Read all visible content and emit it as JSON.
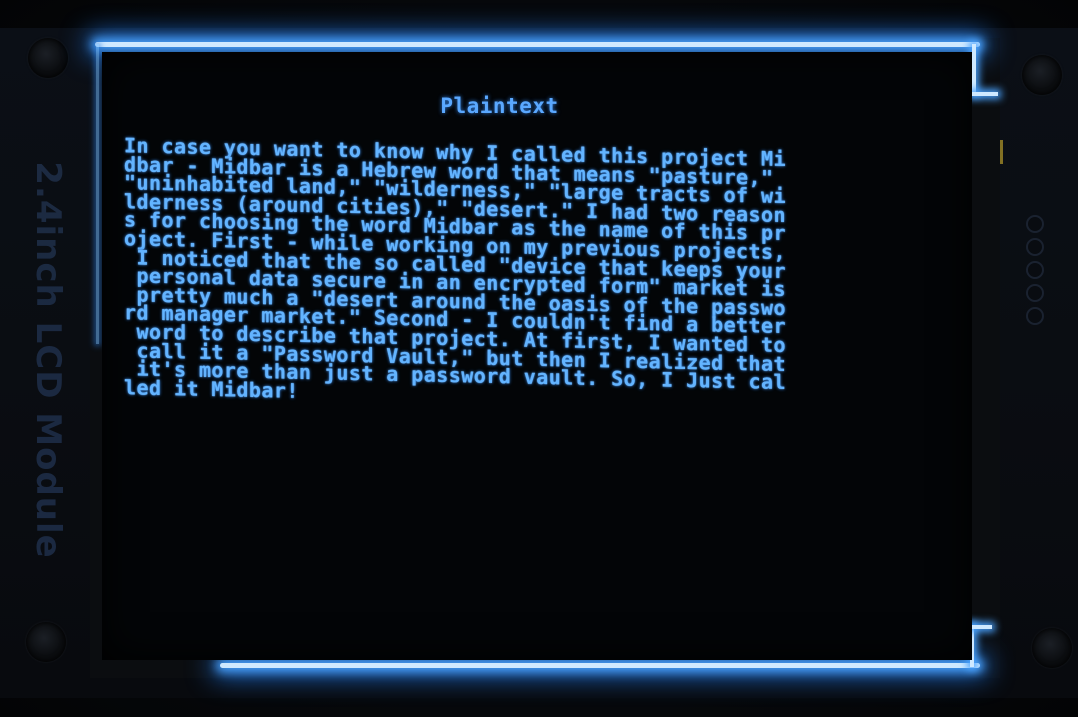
{
  "module": {
    "silkscreen_label": "2.4inch LCD Module"
  },
  "screen": {
    "title": "Plaintext",
    "lines": [
      "In case you want to know why I called this project Mi",
      "dbar - Midbar is a Hebrew word that means \"pasture,\"",
      "\"uninhabited land,\" \"wilderness,\" \"large tracts of wi",
      "lderness (around cities),\" \"desert.\" I had two reason",
      "s for choosing the word Midbar as the name of this pr",
      "oject. First - while working on my previous projects,",
      " I noticed that the so called \"device that keeps your",
      " personal data secure in an encrypted form\" market is",
      " pretty much a \"desert around the oasis of the passwo",
      "rd manager market.\" Second - I couldn't find a better",
      " word to describe that project. At first, I wanted to",
      " call it a \"Password Vault,\" but then I realized that",
      " it's more than just a password vault. So, I Just cal",
      "led it Midbar!"
    ]
  },
  "colors": {
    "text": "#63b4ff",
    "backlight": "#4aa3ff",
    "background": "#030507"
  }
}
